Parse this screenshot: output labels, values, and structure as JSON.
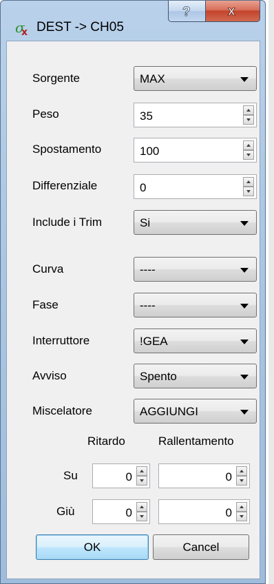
{
  "window": {
    "title": "DEST -> CH05",
    "help_label": "?",
    "close_label": "x"
  },
  "fields": {
    "sorgente": {
      "label": "Sorgente",
      "value": "MAX"
    },
    "peso": {
      "label": "Peso",
      "value": "35"
    },
    "spostamento": {
      "label": "Spostamento",
      "value": "100"
    },
    "differenziale": {
      "label": "Differenziale",
      "value": "0"
    },
    "include_trim": {
      "label": "Include i Trim",
      "value": "Si"
    },
    "curva": {
      "label": "Curva",
      "value": "----"
    },
    "fase": {
      "label": "Fase",
      "value": "----"
    },
    "interruttore": {
      "label": "Interruttore",
      "value": "!GEA"
    },
    "avviso": {
      "label": "Avviso",
      "value": "Spento"
    },
    "miscelatore": {
      "label": "Miscelatore",
      "value": "AGGIUNGI"
    }
  },
  "delay": {
    "col_ritardo": "Ritardo",
    "col_rallentamento": "Rallentamento",
    "su": {
      "label": "Su",
      "ritardo": "0",
      "rallentamento": "0"
    },
    "giu": {
      "label": "Giù",
      "ritardo": "0",
      "rallentamento": "0"
    }
  },
  "buttons": {
    "ok": "OK",
    "cancel": "Cancel"
  },
  "colors": {
    "title_bar": "#b9d1ea",
    "close_button": "#c4432c",
    "default_button": "#bee6fd"
  },
  "icons": [
    "app-sigma-x-icon",
    "help-icon",
    "close-icon",
    "chevron-down-icon",
    "spin-up-icon",
    "spin-down-icon"
  ]
}
